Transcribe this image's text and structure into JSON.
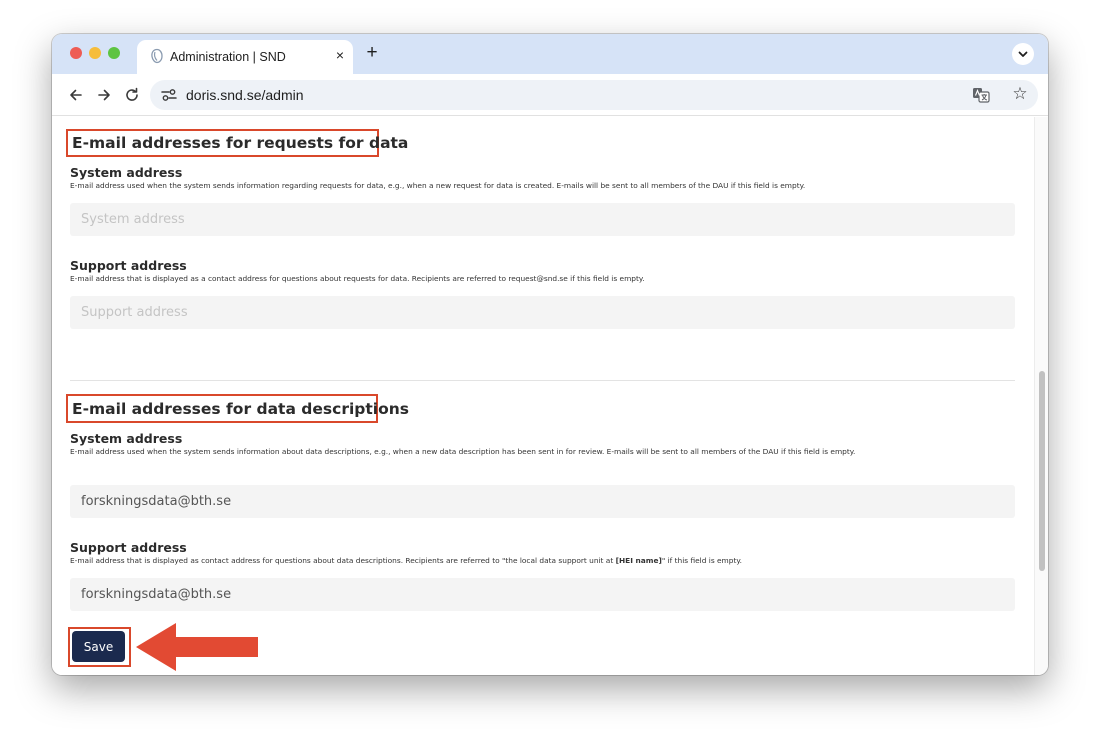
{
  "browser": {
    "tab_title": "Administration | SND",
    "tab_close": "×",
    "new_tab": "+",
    "url": "doris.snd.se/admin",
    "star": "☆"
  },
  "sections": [
    {
      "heading": "E-mail addresses for requests for data",
      "fields": [
        {
          "label": "System address",
          "help": "E-mail address used when the system sends information regarding requests for data, e.g., when a new request for data is created. E-mails will be sent to all members of the DAU if this field is empty.",
          "placeholder": "System address",
          "value": ""
        },
        {
          "label": "Support address",
          "help": "E-mail address that is displayed as a contact address for questions about requests for data. Recipients are referred to request@snd.se if this field is empty.",
          "placeholder": "Support address",
          "value": ""
        }
      ]
    },
    {
      "heading": "E-mail addresses for data descriptions",
      "fields": [
        {
          "label": "System address",
          "help": "E-mail address used when the system sends information about data descriptions, e.g., when a new data description has been sent in for review. E-mails will be sent to all members of the DAU if this field is empty.",
          "placeholder": "",
          "value": "forskningsdata@bth.se"
        },
        {
          "label": "Support address",
          "help_before": "E-mail address that is displayed as contact address for questions about data descriptions. Recipients are referred to \"the local data support unit at ",
          "help_bold": "[HEI name]",
          "help_after": "\" if this field is empty.",
          "placeholder": "",
          "value": "forskningsdata@bth.se"
        }
      ]
    }
  ],
  "save_label": "Save",
  "colors": {
    "highlight": "#d9482b",
    "save_button": "#1b2a4e",
    "tab_bar": "#d6e3f7"
  }
}
